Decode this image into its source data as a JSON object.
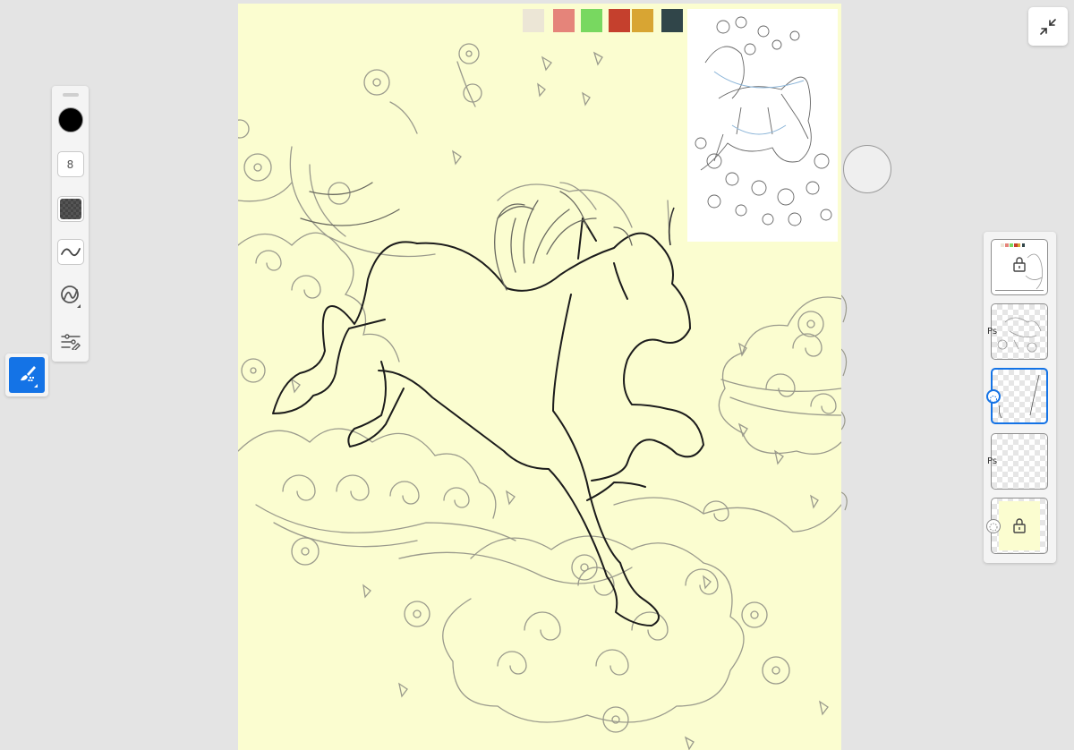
{
  "canvas": {
    "background": "#fbfdd0",
    "swatches": [
      "#ece6d6",
      "#e5847a",
      "#78d860",
      "#c5402d",
      "#d8a533",
      "#304549"
    ]
  },
  "toolbar": {
    "brush_color": "#000000",
    "brush_size": "8",
    "active_tool": "brush-tool"
  },
  "layers": {
    "items": [
      {
        "name": "reference-layer",
        "locked": true,
        "badge": ""
      },
      {
        "name": "sketch-layer",
        "locked": false,
        "badge": "Ps"
      },
      {
        "name": "ink-layer",
        "locked": false,
        "badge": "",
        "selected": true
      },
      {
        "name": "paint-layer",
        "locked": false,
        "badge": "Ps"
      },
      {
        "name": "background-layer",
        "locked": true,
        "badge": ""
      }
    ]
  },
  "colors": {
    "accent": "#1473e6",
    "canvas_fill": "#fbfdd0"
  }
}
